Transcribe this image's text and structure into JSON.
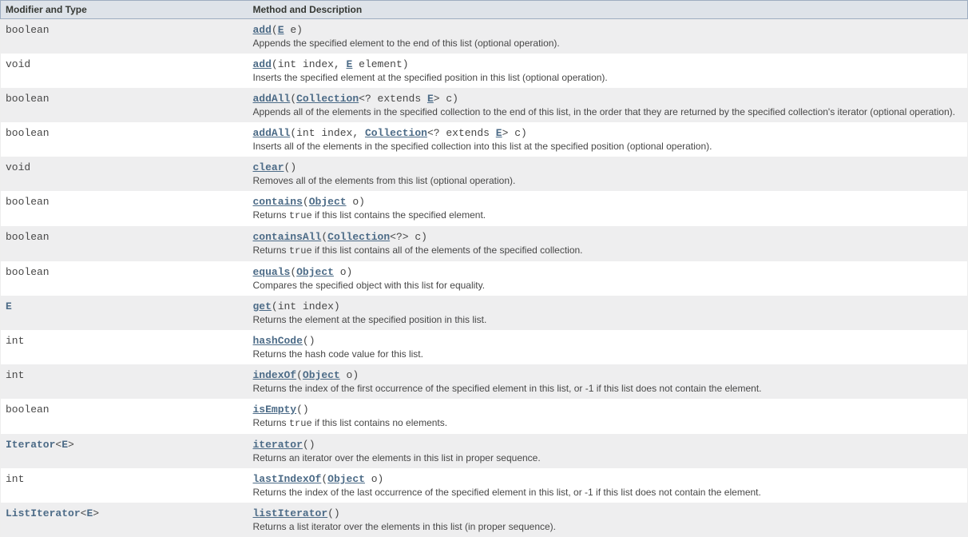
{
  "headers": {
    "col1": "Modifier and Type",
    "col2": "Method and Description"
  },
  "rows": [
    {
      "modifier": [
        {
          "t": "boolean"
        }
      ],
      "sig": [
        {
          "t": "add",
          "k": "name"
        },
        {
          "t": "("
        },
        {
          "t": "E",
          "k": "type"
        },
        {
          "t": " e)"
        }
      ],
      "desc": [
        {
          "t": "Appends the specified element to the end of this list (optional operation)."
        }
      ]
    },
    {
      "modifier": [
        {
          "t": "void"
        }
      ],
      "sig": [
        {
          "t": "add",
          "k": "name"
        },
        {
          "t": "(int index, "
        },
        {
          "t": "E",
          "k": "type"
        },
        {
          "t": " element)"
        }
      ],
      "desc": [
        {
          "t": "Inserts the specified element at the specified position in this list (optional operation)."
        }
      ]
    },
    {
      "modifier": [
        {
          "t": "boolean"
        }
      ],
      "sig": [
        {
          "t": "addAll",
          "k": "name"
        },
        {
          "t": "("
        },
        {
          "t": "Collection",
          "k": "type"
        },
        {
          "t": "<? extends "
        },
        {
          "t": "E",
          "k": "type"
        },
        {
          "t": "> c)"
        }
      ],
      "desc": [
        {
          "t": "Appends all of the elements in the specified collection to the end of this list, in the order that they are returned by the specified collection's iterator (optional operation)."
        }
      ]
    },
    {
      "modifier": [
        {
          "t": "boolean"
        }
      ],
      "sig": [
        {
          "t": "addAll",
          "k": "name"
        },
        {
          "t": "(int index, "
        },
        {
          "t": "Collection",
          "k": "type"
        },
        {
          "t": "<? extends "
        },
        {
          "t": "E",
          "k": "type"
        },
        {
          "t": "> c)"
        }
      ],
      "desc": [
        {
          "t": "Inserts all of the elements in the specified collection into this list at the specified position (optional operation)."
        }
      ]
    },
    {
      "modifier": [
        {
          "t": "void"
        }
      ],
      "sig": [
        {
          "t": "clear",
          "k": "name"
        },
        {
          "t": "()"
        }
      ],
      "desc": [
        {
          "t": "Removes all of the elements from this list (optional operation)."
        }
      ]
    },
    {
      "modifier": [
        {
          "t": "boolean"
        }
      ],
      "sig": [
        {
          "t": "contains",
          "k": "name"
        },
        {
          "t": "("
        },
        {
          "t": "Object",
          "k": "type"
        },
        {
          "t": " o)"
        }
      ],
      "desc": [
        {
          "t": "Returns "
        },
        {
          "t": "true",
          "k": "code"
        },
        {
          "t": " if this list contains the specified element."
        }
      ]
    },
    {
      "modifier": [
        {
          "t": "boolean"
        }
      ],
      "sig": [
        {
          "t": "containsAll",
          "k": "name"
        },
        {
          "t": "("
        },
        {
          "t": "Collection",
          "k": "type"
        },
        {
          "t": "<?> c)"
        }
      ],
      "desc": [
        {
          "t": "Returns "
        },
        {
          "t": "true",
          "k": "code"
        },
        {
          "t": " if this list contains all of the elements of the specified collection."
        }
      ]
    },
    {
      "modifier": [
        {
          "t": "boolean"
        }
      ],
      "sig": [
        {
          "t": "equals",
          "k": "name"
        },
        {
          "t": "("
        },
        {
          "t": "Object",
          "k": "type"
        },
        {
          "t": " o)"
        }
      ],
      "desc": [
        {
          "t": "Compares the specified object with this list for equality."
        }
      ]
    },
    {
      "modifier": [
        {
          "t": "E",
          "k": "link"
        }
      ],
      "sig": [
        {
          "t": "get",
          "k": "name"
        },
        {
          "t": "(int index)"
        }
      ],
      "desc": [
        {
          "t": "Returns the element at the specified position in this list."
        }
      ]
    },
    {
      "modifier": [
        {
          "t": "int"
        }
      ],
      "sig": [
        {
          "t": "hashCode",
          "k": "name"
        },
        {
          "t": "()"
        }
      ],
      "desc": [
        {
          "t": "Returns the hash code value for this list."
        }
      ]
    },
    {
      "modifier": [
        {
          "t": "int"
        }
      ],
      "sig": [
        {
          "t": "indexOf",
          "k": "name"
        },
        {
          "t": "("
        },
        {
          "t": "Object",
          "k": "type"
        },
        {
          "t": " o)"
        }
      ],
      "desc": [
        {
          "t": "Returns the index of the first occurrence of the specified element in this list, or -1 if this list does not contain the element."
        }
      ]
    },
    {
      "modifier": [
        {
          "t": "boolean"
        }
      ],
      "sig": [
        {
          "t": "isEmpty",
          "k": "name"
        },
        {
          "t": "()"
        }
      ],
      "desc": [
        {
          "t": "Returns "
        },
        {
          "t": "true",
          "k": "code"
        },
        {
          "t": " if this list contains no elements."
        }
      ]
    },
    {
      "modifier": [
        {
          "t": "Iterator",
          "k": "link"
        },
        {
          "t": "<"
        },
        {
          "t": "E",
          "k": "link"
        },
        {
          "t": ">"
        }
      ],
      "sig": [
        {
          "t": "iterator",
          "k": "name"
        },
        {
          "t": "()"
        }
      ],
      "desc": [
        {
          "t": "Returns an iterator over the elements in this list in proper sequence."
        }
      ]
    },
    {
      "modifier": [
        {
          "t": "int"
        }
      ],
      "sig": [
        {
          "t": "lastIndexOf",
          "k": "name"
        },
        {
          "t": "("
        },
        {
          "t": "Object",
          "k": "type"
        },
        {
          "t": " o)"
        }
      ],
      "desc": [
        {
          "t": "Returns the index of the last occurrence of the specified element in this list, or -1 if this list does not contain the element."
        }
      ]
    },
    {
      "modifier": [
        {
          "t": "ListIterator",
          "k": "link"
        },
        {
          "t": "<"
        },
        {
          "t": "E",
          "k": "link"
        },
        {
          "t": ">"
        }
      ],
      "sig": [
        {
          "t": "listIterator",
          "k": "name"
        },
        {
          "t": "()"
        }
      ],
      "desc": [
        {
          "t": "Returns a list iterator over the elements in this list (in proper sequence)."
        }
      ]
    }
  ]
}
